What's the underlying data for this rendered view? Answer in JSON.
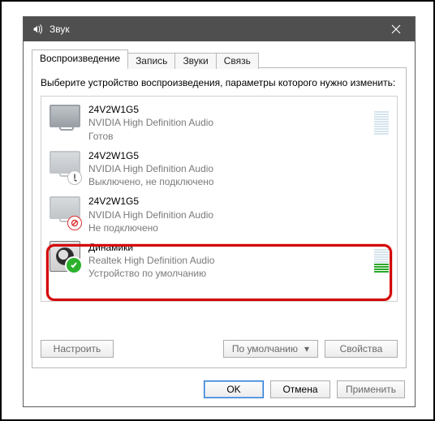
{
  "window": {
    "title": "Звук"
  },
  "tabs": {
    "playback": "Воспроизведение",
    "recording": "Запись",
    "sounds": "Звуки",
    "comm": "Связь"
  },
  "instruction": "Выберите устройство воспроизведения, параметры которого нужно изменить:",
  "devices": [
    {
      "name": "24V2W1G5",
      "sub1": "NVIDIA High Definition Audio",
      "sub2": "Готов",
      "activeBars": 0
    },
    {
      "name": "24V2W1G5",
      "sub1": "NVIDIA High Definition Audio",
      "sub2": "Выключено, не подключено",
      "activeBars": 0
    },
    {
      "name": "24V2W1G5",
      "sub1": "NVIDIA High Definition Audio",
      "sub2": "Не подключено",
      "activeBars": 0
    },
    {
      "name": "Динамики",
      "sub1": "Realtek High Definition Audio",
      "sub2": "Устройство по умолчанию",
      "activeBars": 4
    }
  ],
  "panelButtons": {
    "configure": "Настроить",
    "default": "По умолчанию",
    "properties": "Свойства"
  },
  "dialogButtons": {
    "ok": "OK",
    "cancel": "Отмена",
    "apply": "Применить"
  }
}
